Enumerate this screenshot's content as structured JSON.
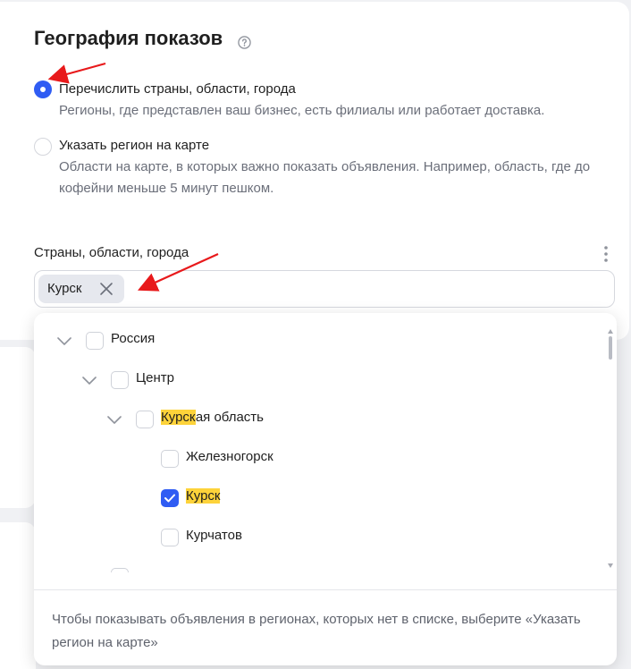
{
  "section": {
    "title": "География показов",
    "help_icon": "question-circle-icon"
  },
  "options": [
    {
      "title": "Перечислить страны, области, города",
      "description": "Регионы, где представлен ваш бизнес, есть филиалы или работает доставка.",
      "selected": true
    },
    {
      "title": "Указать регион на карте",
      "description": "Области на карте, в которых важно показать объявления. Например, область, где до кофейни меньше 5 минут пешком.",
      "selected": false
    }
  ],
  "field": {
    "label": "Страны, области, города",
    "more_icon": "more-vertical-icon",
    "chips": [
      {
        "label": "Курск"
      }
    ]
  },
  "tree": {
    "items": [
      {
        "label": "Россия",
        "highlight": "",
        "rest": "Россия",
        "level": 0,
        "expandable": true,
        "checked": false
      },
      {
        "label": "Центр",
        "highlight": "",
        "rest": "Центр",
        "level": 1,
        "expandable": true,
        "checked": false
      },
      {
        "label": "Курская область",
        "highlight": "Курск",
        "rest": "ая область",
        "level": 2,
        "expandable": true,
        "checked": false
      },
      {
        "label": "Железногорск",
        "highlight": "",
        "rest": "Железногорск",
        "level": 3,
        "expandable": false,
        "checked": false
      },
      {
        "label": "Курск",
        "highlight": "Курск",
        "rest": "",
        "level": 3,
        "expandable": false,
        "checked": true
      },
      {
        "label": "Курчатов",
        "highlight": "",
        "rest": "Курчатов",
        "level": 3,
        "expandable": false,
        "checked": false
      }
    ]
  },
  "dropdown_hint": "Чтобы показывать объявления в регионах, которых нет в списке, выберите «Указать регион на карте»",
  "colors": {
    "accent": "#2f5cf3",
    "highlight": "#fdd33a",
    "annotation_arrow": "#e8191b"
  }
}
